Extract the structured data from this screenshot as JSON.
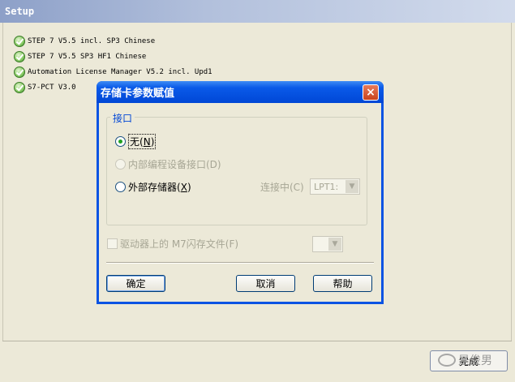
{
  "setup": {
    "title": "Setup",
    "items": [
      "STEP 7  V5.5 incl. SP3 Chinese",
      "STEP 7  V5.5 SP3 HF1 Chinese",
      "Automation License Manager V5.2 incl. Upd1",
      "S7-PCT V3.0"
    ],
    "finish_button": "完成",
    "watermark": "是俊男"
  },
  "dialog": {
    "title": "存储卡参数赋值",
    "close_symbol": "×",
    "group_label": "接口",
    "radio_none": "无",
    "radio_none_key": "N",
    "radio_internal": "内部编程设备接口(D)",
    "radio_external": "外部存储器",
    "radio_external_key": "X",
    "connection_label": "连接中(C)",
    "connection_value": "LPT1:",
    "checkbox_label": "驱动器上的 M7闪存文件(F)",
    "ok_button": "确定",
    "cancel_button": "取消",
    "help_button": "帮助",
    "dropdown_arrow": "▼"
  }
}
